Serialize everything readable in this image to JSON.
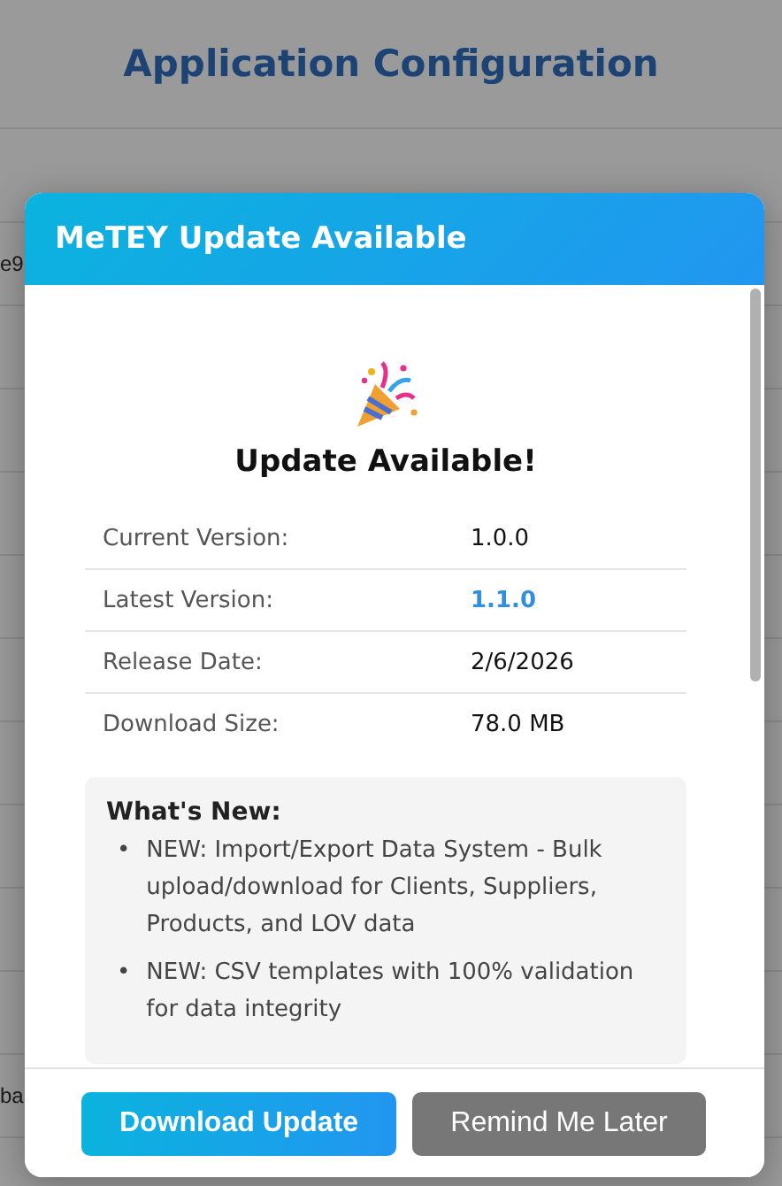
{
  "page": {
    "title": "Application Configuration"
  },
  "background_table": {
    "rows": [
      {
        "column_1": "e9"
      },
      {
        "column_1": "ba"
      }
    ]
  },
  "dialog": {
    "title": "MeTEY Update Available",
    "heading": "Update Available!",
    "details": [
      {
        "label": "Current Version:",
        "value": "1.0.0",
        "kind": "plain"
      },
      {
        "label": "Latest Version:",
        "value": "1.1.0",
        "kind": "highlight"
      },
      {
        "label": "Release Date:",
        "value": "2/6/2026",
        "kind": "plain"
      },
      {
        "label": "Download Size:",
        "value": "78.0 MB",
        "kind": "plain"
      }
    ],
    "whats_new": {
      "title": "What's New:",
      "items": [
        {
          "marker": "•",
          "text": "NEW: Import/Export Data System - Bulk upload/download for Clients, Suppliers, Products, and LOV data"
        },
        {
          "marker": "•",
          "text": "NEW: CSV templates with 100% validation for data integrity"
        }
      ]
    },
    "buttons": [
      {
        "label": "Download Update",
        "kind": "primary"
      },
      {
        "label": "Remind Me Later",
        "kind": "secondary"
      }
    ]
  }
}
